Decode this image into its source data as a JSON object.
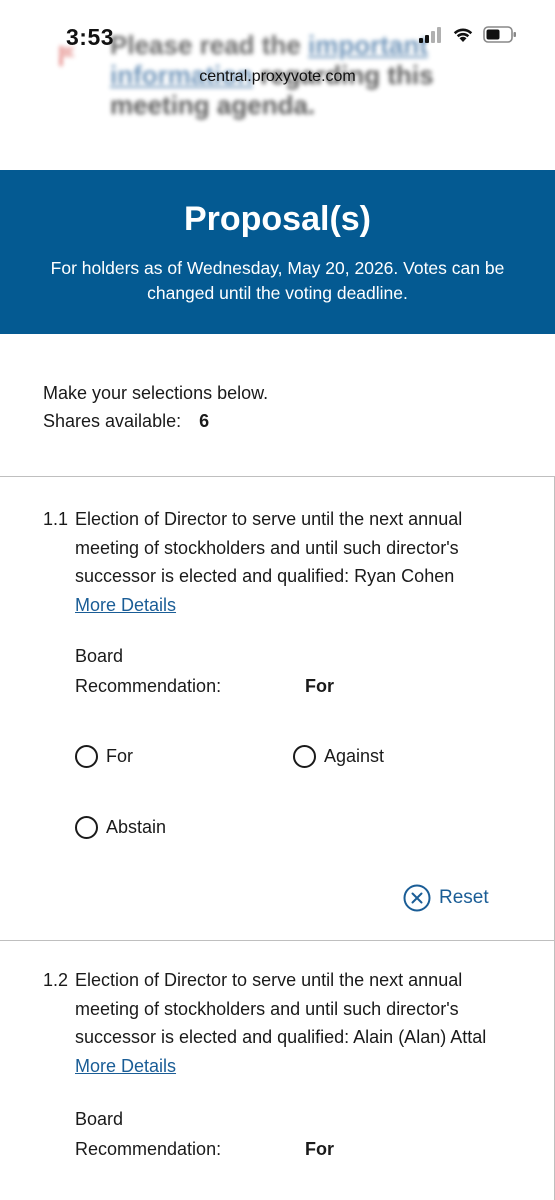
{
  "status_bar": {
    "time": "3:53",
    "url": "central.proxyvote.com"
  },
  "background_notice": {
    "prefix": "Please read the ",
    "link": "important information",
    "suffix": " regarding this meeting agenda."
  },
  "banner": {
    "title": "Proposal(s)",
    "subtitle": "For holders as of Wednesday, May 20, 2026. Votes can be changed until the voting deadline."
  },
  "intro": {
    "instruction": "Make your selections below.",
    "shares_label": "Shares available:",
    "shares_value": "6"
  },
  "proposals": [
    {
      "number": "1.1",
      "description": "Election of Director to serve until the next annual meeting of stockholders and until such director's successor is elected and qualified: Ryan Cohen",
      "more_details": "More Details",
      "board_label_line1": "Board",
      "board_label_line2": "Recommendation:",
      "board_value": "For",
      "options": [
        "For",
        "Against",
        "Abstain"
      ],
      "reset_label": "Reset"
    },
    {
      "number": "1.2",
      "description": "Election of Director to serve until the next annual meeting of stockholders and until such director's successor is elected and qualified: Alain (Alan) Attal",
      "more_details": "More Details",
      "board_label_line1": "Board",
      "board_label_line2": "Recommendation:",
      "board_value": "For"
    }
  ],
  "colors": {
    "banner": "#045a92",
    "link": "#1a5d96"
  }
}
